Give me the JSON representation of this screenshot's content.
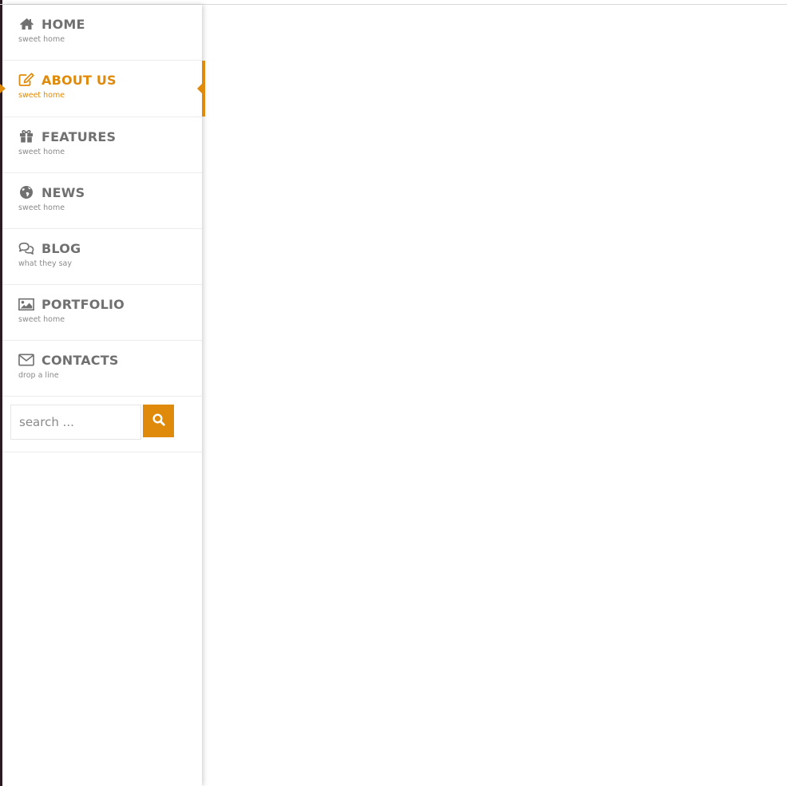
{
  "nav": {
    "items": [
      {
        "label": "HOME",
        "sub": "sweet home",
        "icon": "home-icon"
      },
      {
        "label": "ABOUT US",
        "sub": "sweet home",
        "icon": "edit-icon",
        "active": true
      },
      {
        "label": "FEATURES",
        "sub": "sweet home",
        "icon": "gift-icon"
      },
      {
        "label": "NEWS",
        "sub": "sweet home",
        "icon": "globe-icon"
      },
      {
        "label": "BLOG",
        "sub": "what they say",
        "icon": "comments-icon"
      },
      {
        "label": "PORTFOLIO",
        "sub": "sweet home",
        "icon": "image-icon"
      },
      {
        "label": "CONTACTS",
        "sub": "drop a line",
        "icon": "envelope-icon"
      }
    ]
  },
  "search": {
    "placeholder": "search ...",
    "icon": "search-icon"
  },
  "colors": {
    "accent": "#e08a0b",
    "text": "#707070",
    "subtext": "#8a8a8a"
  }
}
